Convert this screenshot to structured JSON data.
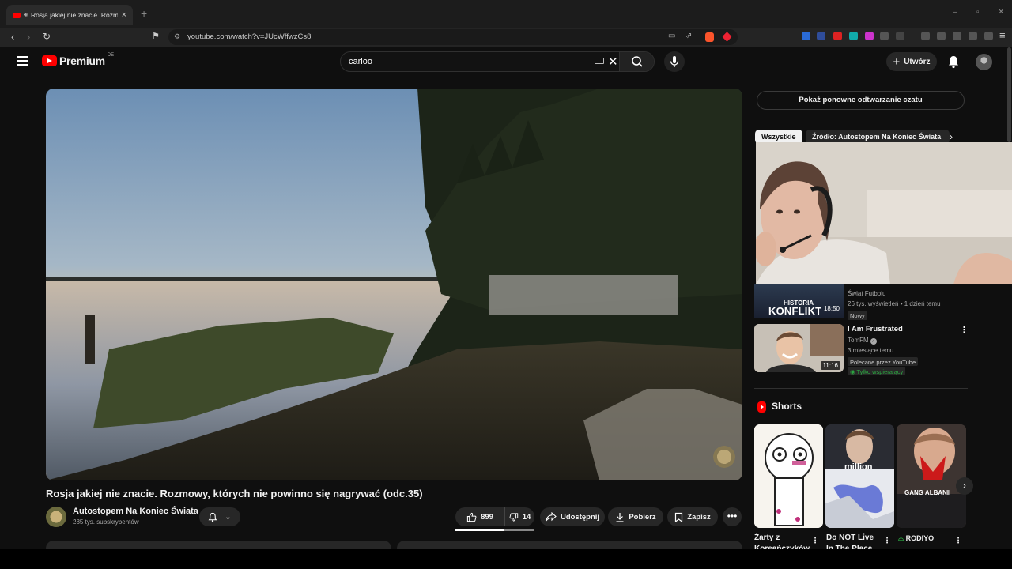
{
  "browser": {
    "tab_title": "Rosja jakiej nie znacie. Rozmo",
    "new_tab": "+",
    "url": "youtube.com/watch?v=JUcWffwzCs8",
    "win_min": "–",
    "win_max": "▫",
    "win_close": "✕"
  },
  "youtube": {
    "logo_text": "Premium",
    "country": "DE",
    "search_value": "carloo",
    "create_label": "Utwórz"
  },
  "video": {
    "title": "Rosja jakiej nie znacie. Rozmowy, których nie powinno się nagrywać (odc.35)",
    "channel": "Autostopem Na Koniec Świata",
    "subscribers": "285 tys. subskrybentów",
    "likes": "899",
    "dislikes": "14",
    "share_label": "Udostępnij",
    "download_label": "Pobierz",
    "save_label": "Zapisz",
    "more_label": "•••"
  },
  "sidebar": {
    "chat_replay_label": "Pokaż ponowne odtwarzanie czatu",
    "chips": [
      "Wszystkie",
      "Źródło: Autostopem Na Koniec Świata"
    ],
    "rec1": {
      "thumb_line1": "HISTORIA",
      "thumb_line2": "KONFLIKT",
      "duration": "18:50",
      "channel": "Świat Futbolu",
      "meta": "26 tys. wyświetleń • 1 dzień temu",
      "badge": "Nowy"
    },
    "rec2": {
      "title": "I Am Frustrated",
      "channel": "TomFM",
      "verified": "✓",
      "meta": "3 miesiące temu",
      "duration": "11:16",
      "tag_recommended": "Polecane przez YouTube",
      "tag_members": "Tylko wspierający"
    },
    "shorts_title": "Shorts",
    "shorts": [
      {
        "title": "Żarty z Koreańczyków"
      },
      {
        "title": "Do NOT Live In The Place",
        "thumb_text": "million"
      },
      {
        "title": "GANG ALBANII",
        "thumb_text": "GANG ALBANII"
      }
    ],
    "short3_prefix": "RODIYO"
  },
  "colors": {
    "background": "#0f0f0f",
    "surface": "#272727",
    "brand_red": "#ff0000",
    "members_green": "#2ba640"
  }
}
